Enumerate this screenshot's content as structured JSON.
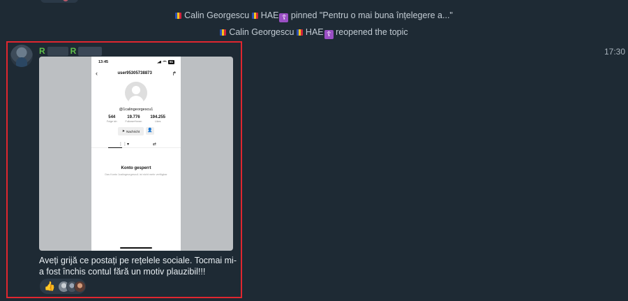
{
  "service_messages": [
    {
      "actor": "Calin Georgescu",
      "suffix": "HAE",
      "badge": "☦",
      "action": " pinned \"Pentru o mai buna înțelegere a...\""
    },
    {
      "actor": "Calin Georgescu",
      "suffix": "HAE",
      "badge": "☦",
      "action": " reopened the topic"
    }
  ],
  "message": {
    "sender_initial_1": "R",
    "sender_initial_2": "R",
    "time": "17:30",
    "caption": "Aveți grijă ce postați pe rețelele sociale. Tocmai mi-a fost închis contul fără un motiv plauzibil!!!",
    "reaction_emoji": "👍"
  },
  "screenshot": {
    "status_time": "13:45",
    "battery": "51",
    "username": "user95305738873",
    "handle": "@1calingeorgescu1",
    "stats": [
      {
        "value": "544",
        "label": "Folge ich"
      },
      {
        "value": "19.776",
        "label": "Follower*innen"
      },
      {
        "value": "194.255",
        "label": "Likes"
      }
    ],
    "message_button": "Nachricht",
    "locked_title": "Konto gesperrt",
    "locked_subtitle": "Das Konto 1calingeorgescu1 ist nicht mehr verfügbar"
  },
  "colors": {
    "background": "#1e2a34",
    "highlight_border": "#e0262f",
    "sender_name": "#5fc04a"
  }
}
